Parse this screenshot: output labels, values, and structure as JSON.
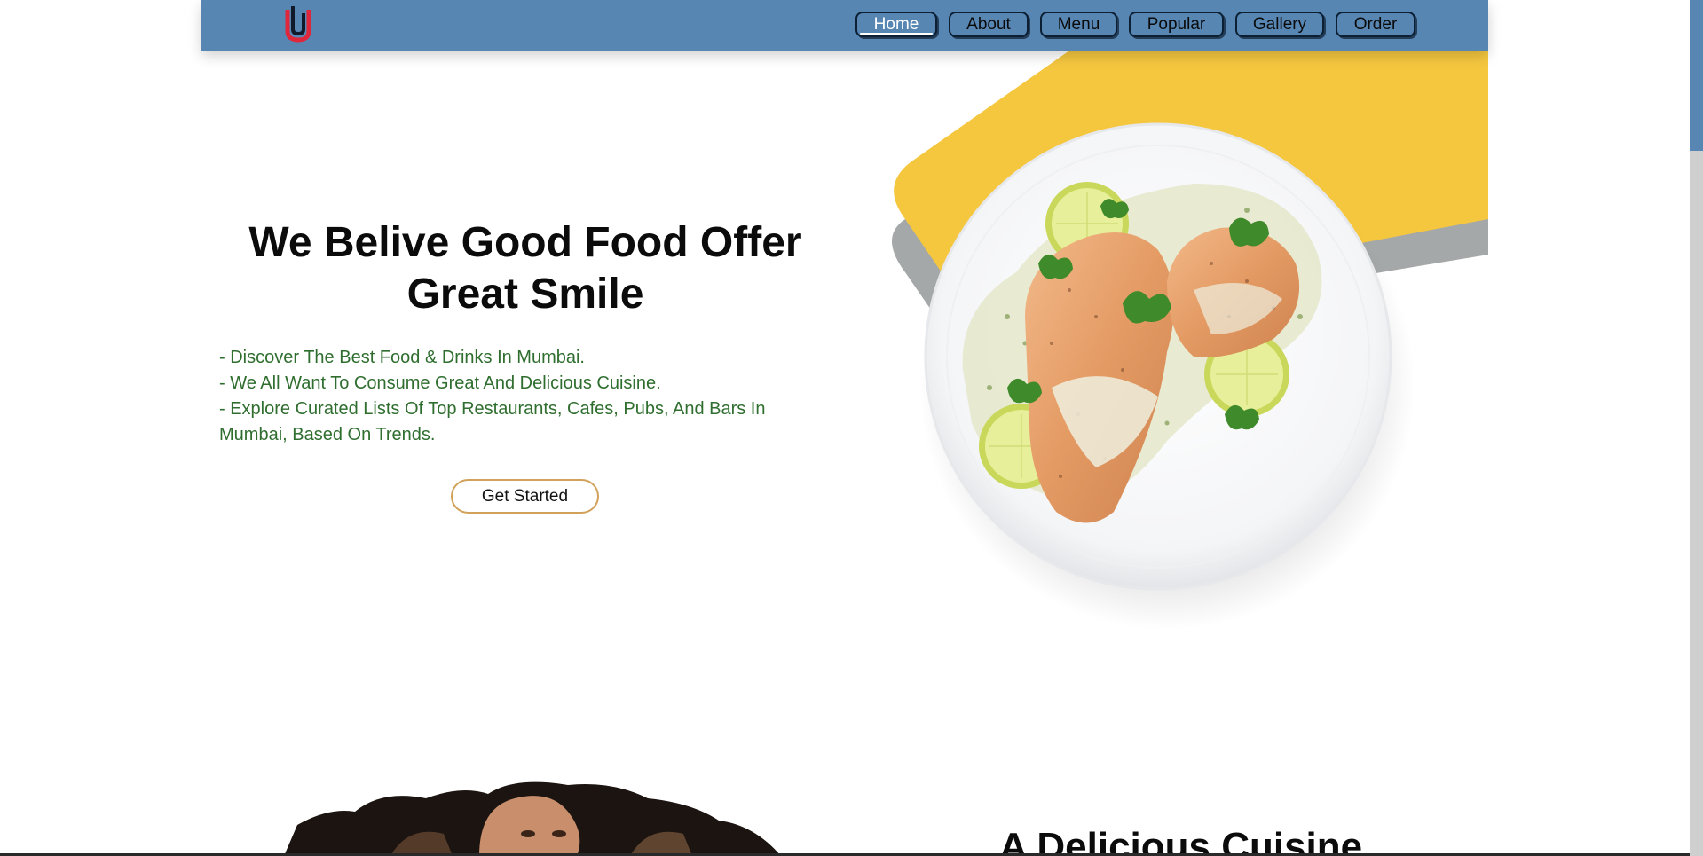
{
  "header": {
    "logo_letter": "U",
    "nav": [
      {
        "label": "Home",
        "active": true
      },
      {
        "label": "About",
        "active": false
      },
      {
        "label": "Menu",
        "active": false
      },
      {
        "label": "Popular",
        "active": false
      },
      {
        "label": "Gallery",
        "active": false
      },
      {
        "label": "Order",
        "active": false
      }
    ]
  },
  "hero": {
    "title": "We Belive Good Food Offer Great Smile",
    "points": [
      "- Discover The Best Food & Drinks In Mumbai.",
      "- We All Want To Consume Great And Delicious Cuisine.",
      "- Explore Curated Lists Of Top Restaurants, Cafes, Pubs, And Bars In Mumbai, Based On Trends."
    ],
    "cta_label": "Get Started"
  },
  "section2": {
    "title": "A Delicious Cuisine"
  },
  "colors": {
    "header_bg": "#5886b3",
    "accent_yellow": "#f5c73f",
    "text_green": "#2f6e2f",
    "cta_border": "#d2a15a"
  }
}
